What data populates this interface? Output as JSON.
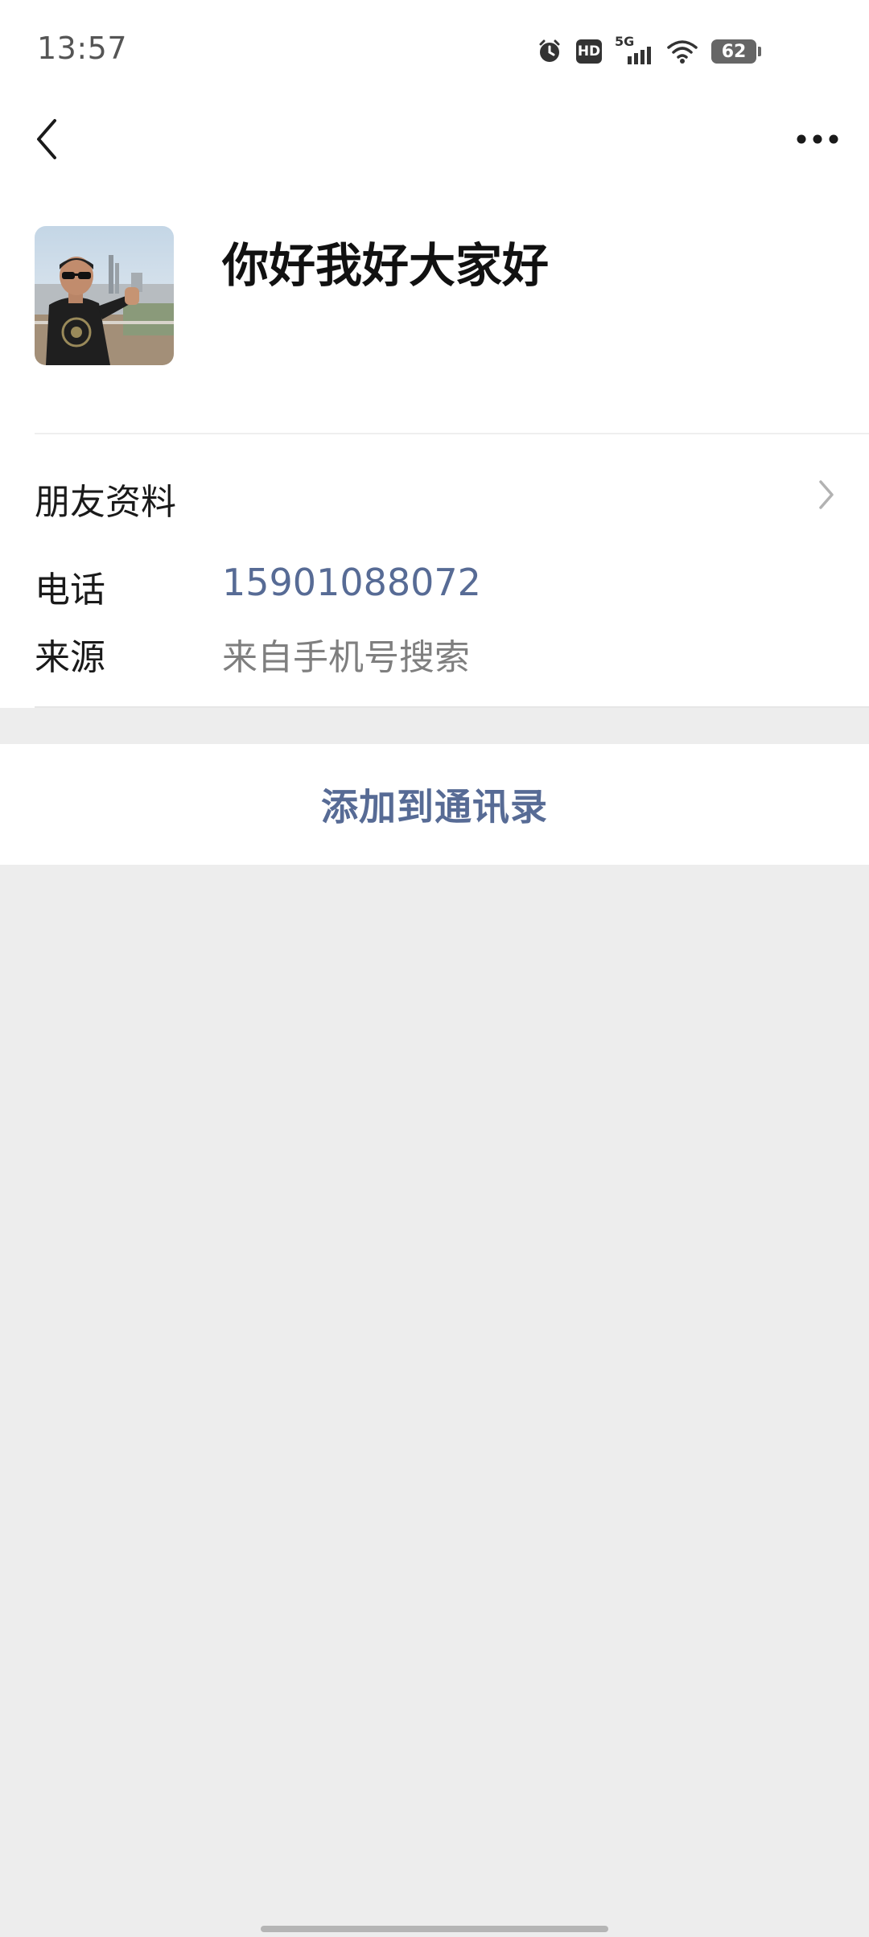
{
  "status_bar": {
    "time": "13:57",
    "network": "5G",
    "hd_badge": "HD",
    "battery_level": "62",
    "icons": [
      "alarm-icon",
      "hd-icon",
      "signal-5g-icon",
      "wifi-icon",
      "battery-icon"
    ]
  },
  "header": {
    "back_icon": "chevron-left-icon",
    "more_icon": "more-horizontal-icon"
  },
  "profile": {
    "name": "你好我好大家好"
  },
  "friend_info": {
    "label": "朋友资料"
  },
  "details": {
    "phone_label": "电话",
    "phone_value": "15901088072",
    "source_label": "来源",
    "source_value": "来自手机号搜索"
  },
  "actions": {
    "add_to_contacts": "添加到通讯录"
  },
  "colors": {
    "link": "#576b95",
    "background": "#ededed",
    "card": "#ffffff",
    "secondary_text": "#7f7f7f"
  }
}
